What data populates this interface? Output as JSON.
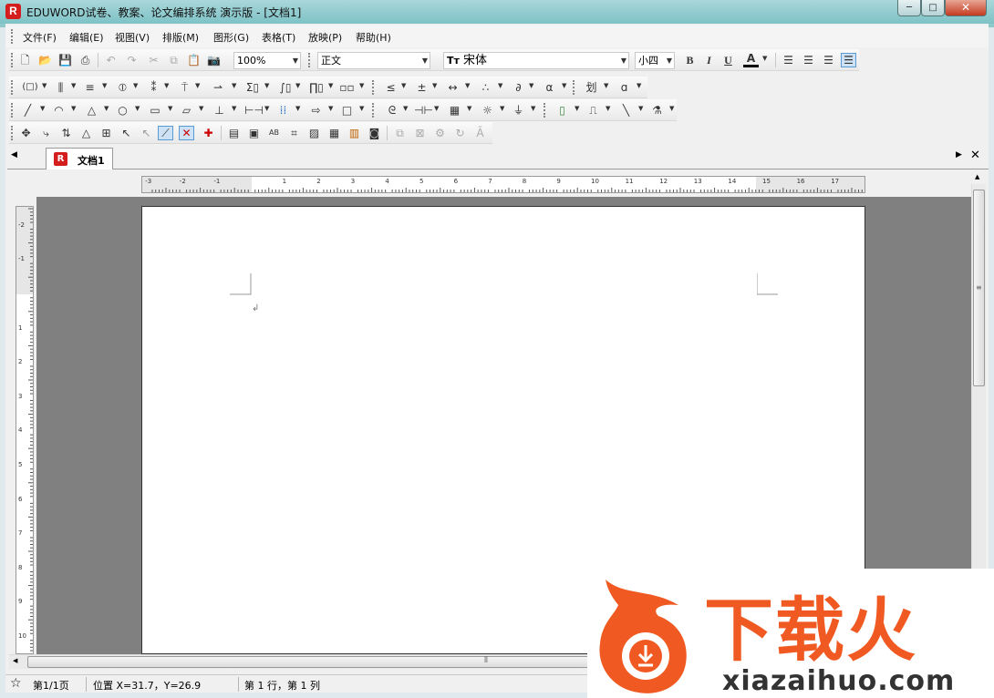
{
  "window": {
    "title": "EDUWORD试卷、教案、论文编排系统 演示版 - [文档1]",
    "app_icon_letter": "R",
    "min_label": "─",
    "max_label": "□",
    "close_label": "✕"
  },
  "menu": [
    "文件(F)",
    "编辑(E)",
    "视图(V)",
    "排版(M)",
    "图形(G)",
    "表格(T)",
    "放映(P)",
    "帮助(H)"
  ],
  "toolbar1": {
    "zoom": "100%",
    "style": "正文",
    "font_icon": "Tт",
    "font": "宋体",
    "size": "小四",
    "bold": "B",
    "italic": "I",
    "underline": "U",
    "font_color": "A"
  },
  "doc_tab": {
    "label": "文档1",
    "icon_letter": "R"
  },
  "ruler": {
    "h_ticks": [
      "-3",
      "-2",
      "-1",
      "1",
      "2",
      "3",
      "4",
      "5",
      "6",
      "7",
      "8",
      "9",
      "10",
      "11",
      "12",
      "13",
      "14",
      "15",
      "16",
      "17"
    ],
    "v_ticks": [
      "-2",
      "-1",
      "1",
      "2",
      "3",
      "4",
      "5",
      "6",
      "7",
      "8",
      "9",
      "10"
    ]
  },
  "document": {
    "paragraph_mark": "↲"
  },
  "status": {
    "page": "第1/1页",
    "position": "位置 X=31.7，Y=26.9",
    "line_col": "第 1 行，第 1 列"
  },
  "watermark": {
    "brand": "下载火",
    "url": "xiazaihuo.com"
  },
  "colors": {
    "title_bar": "#7ec2c6",
    "brand_red": "#d41d1d",
    "watermark_orange": "#f05a22",
    "page_bg": "#ffffff",
    "workspace_gray": "#808080"
  }
}
